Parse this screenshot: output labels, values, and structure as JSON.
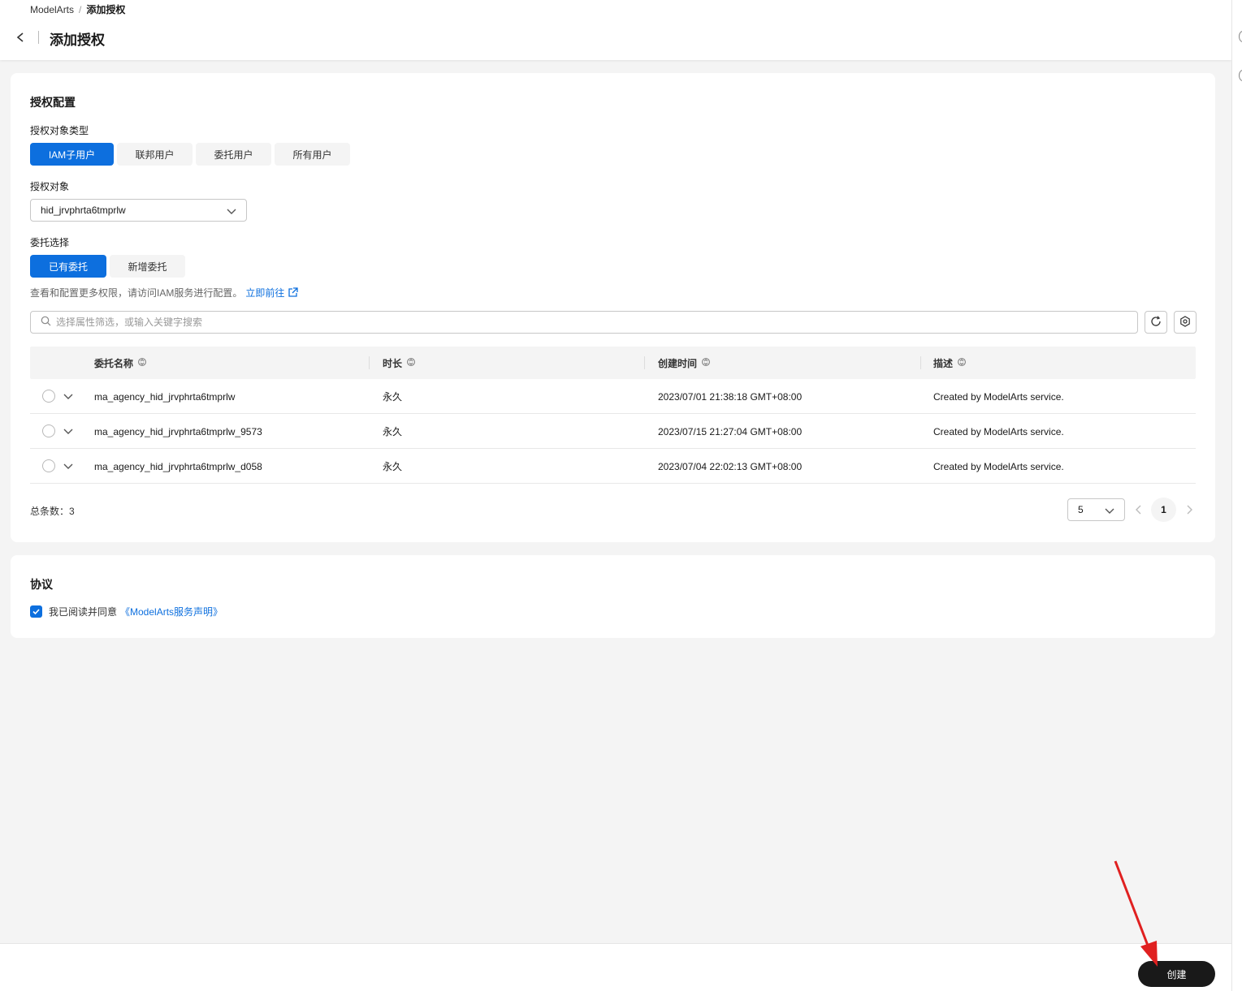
{
  "breadcrumb": {
    "root": "ModelArts",
    "separator": "/",
    "current": "添加授权"
  },
  "header": {
    "title": "添加授权"
  },
  "config": {
    "section_title": "授权配置",
    "object_type_label": "授权对象类型",
    "object_types": [
      "IAM子用户",
      "联邦用户",
      "委托用户",
      "所有用户"
    ],
    "object_types_active": "IAM子用户",
    "object_label": "授权对象",
    "object_value": "hid_jrvphrta6tmprlw",
    "agency_label": "委托选择",
    "agency_options": [
      "已有委托",
      "新增委托"
    ],
    "agency_active": "已有委托",
    "hint_text": "查看和配置更多权限，请访问IAM服务进行配置。",
    "hint_link": "立即前往",
    "search_placeholder": "选择属性筛选，或输入关键字搜索"
  },
  "table": {
    "columns": [
      "委托名称",
      "时长",
      "创建时间",
      "描述"
    ],
    "rows": [
      {
        "name": "ma_agency_hid_jrvphrta6tmprlw",
        "duration": "永久",
        "created": "2023/07/01 21:38:18 GMT+08:00",
        "desc": "Created by ModelArts service."
      },
      {
        "name": "ma_agency_hid_jrvphrta6tmprlw_9573",
        "duration": "永久",
        "created": "2023/07/15 21:27:04 GMT+08:00",
        "desc": "Created by ModelArts service."
      },
      {
        "name": "ma_agency_hid_jrvphrta6tmprlw_d058",
        "duration": "永久",
        "created": "2023/07/04 22:02:13 GMT+08:00",
        "desc": "Created by ModelArts service."
      }
    ]
  },
  "pagination": {
    "total_label": "总条数：3",
    "page_size": "5",
    "current_page": "1"
  },
  "agreement": {
    "section_title": "协议",
    "text": "我已阅读并同意",
    "link": "《ModelArts服务声明》",
    "checked": true
  },
  "footer": {
    "create_label": "创建"
  },
  "colors": {
    "accent": "#0d6fde",
    "primary_dark": "#191919",
    "annotation_arrow": "#e02020"
  }
}
